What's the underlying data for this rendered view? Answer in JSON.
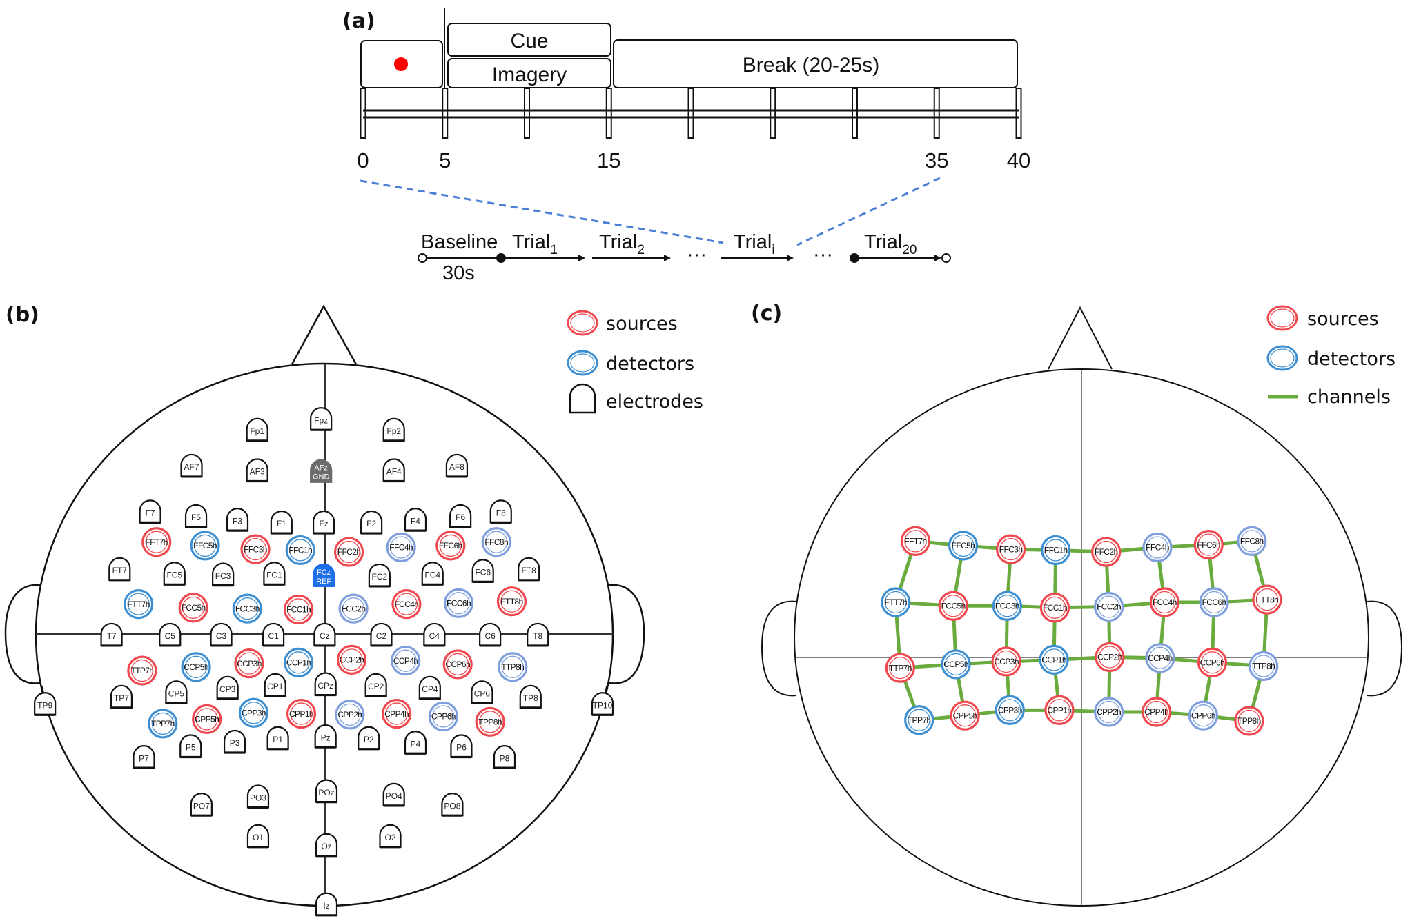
{
  "panels": {
    "a": {
      "label": "(a)",
      "boxes": {
        "fixation_dot_color": "#ff0000",
        "cue": "Cue",
        "imagery": "Imagery",
        "break": "Break (20-25s)"
      },
      "timeline": {
        "ticks_seconds": [
          0,
          5,
          10,
          15,
          20,
          25,
          30,
          35,
          40
        ],
        "tick_labels": [
          "0",
          "5",
          "15",
          "35",
          "40"
        ],
        "tick_label_values": [
          0,
          5,
          15,
          35,
          40
        ]
      },
      "session_flow": {
        "baseline": "Baseline",
        "baseline_duration": "30s",
        "trials": [
          {
            "base": "Trial",
            "sub": "1"
          },
          {
            "base": "Trial",
            "sub": "2"
          },
          {
            "base": "Trial",
            "sub": "i"
          },
          {
            "base": "Trial",
            "sub": "20"
          }
        ],
        "ellipsis": "···"
      }
    },
    "b": {
      "label": "(b)",
      "legend": [
        {
          "key": "sources",
          "label": "sources",
          "color": "#f0484f"
        },
        {
          "key": "detectors",
          "label": "detectors",
          "color": "#3d8fd1"
        },
        {
          "key": "electrodes",
          "label": "electrodes",
          "color": "#111111"
        }
      ],
      "special_electrodes": {
        "AFz": {
          "line1": "AFz",
          "line2": "GND",
          "color": "#6b6b6b"
        },
        "FCz": {
          "line1": "FCz",
          "line2": "REF",
          "color": "#1f6fe8"
        }
      },
      "electrodes": [
        "Fpz",
        "Fp1",
        "Fp2",
        "AF7",
        "AF3",
        "AFz",
        "AF4",
        "AF8",
        "F7",
        "F5",
        "F3",
        "F1",
        "Fz",
        "F2",
        "F4",
        "F6",
        "F8",
        "FT7",
        "FC5",
        "FC3",
        "FC1",
        "FCz",
        "FC2",
        "FC4",
        "FC6",
        "FT8",
        "T7",
        "C5",
        "C3",
        "C1",
        "Cz",
        "C2",
        "C4",
        "C6",
        "T8",
        "TP7",
        "CP5",
        "CP3",
        "CP1",
        "CPz",
        "CP2",
        "CP4",
        "CP6",
        "TP8",
        "TP9",
        "TP10",
        "P7",
        "P5",
        "P3",
        "P1",
        "Pz",
        "P2",
        "P4",
        "P6",
        "P8",
        "PO7",
        "PO3",
        "POz",
        "PO4",
        "PO8",
        "O1",
        "Oz",
        "O2",
        "Iz"
      ]
    },
    "c": {
      "label": "(c)",
      "legend": [
        {
          "key": "sources",
          "label": "sources",
          "color": "#f0484f"
        },
        {
          "key": "detectors",
          "label": "detectors",
          "color": "#3d8fd1"
        },
        {
          "key": "channels",
          "label": "channels",
          "color": "#6aab3e"
        }
      ]
    }
  },
  "optodes": {
    "colors": {
      "source": "#f0484f",
      "detector_left": "#3d8fd1",
      "detector_right": "#7f9fdc",
      "channel": "#6aab3e"
    },
    "rows": [
      [
        {
          "name": "FFT7h",
          "type": "S"
        },
        {
          "name": "FFC5h",
          "type": "D"
        },
        {
          "name": "FFC3h",
          "type": "S"
        },
        {
          "name": "FFC1h",
          "type": "D"
        },
        {
          "name": "FFC2h",
          "type": "S"
        },
        {
          "name": "FFC4h",
          "type": "D"
        },
        {
          "name": "FFC6h",
          "type": "S"
        },
        {
          "name": "FFC8h",
          "type": "D"
        }
      ],
      [
        {
          "name": "FTT7h",
          "type": "D"
        },
        {
          "name": "FCC5h",
          "type": "S"
        },
        {
          "name": "FCC3h",
          "type": "D"
        },
        {
          "name": "FCC1h",
          "type": "S"
        },
        {
          "name": "FCC2h",
          "type": "D"
        },
        {
          "name": "FCC4h",
          "type": "S"
        },
        {
          "name": "FCC6h",
          "type": "D"
        },
        {
          "name": "FTT8h",
          "type": "S"
        }
      ],
      [
        {
          "name": "TTP7h",
          "type": "S"
        },
        {
          "name": "CCP5h",
          "type": "D"
        },
        {
          "name": "CCP3h",
          "type": "S"
        },
        {
          "name": "CCP1h",
          "type": "D"
        },
        {
          "name": "CCP2h",
          "type": "S"
        },
        {
          "name": "CCP4h",
          "type": "D"
        },
        {
          "name": "CCP6h",
          "type": "S"
        },
        {
          "name": "TTP8h",
          "type": "D"
        }
      ],
      [
        {
          "name": "TPP7h",
          "type": "D"
        },
        {
          "name": "CPP5h",
          "type": "S"
        },
        {
          "name": "CPP3h",
          "type": "D"
        },
        {
          "name": "CPP1h",
          "type": "S"
        },
        {
          "name": "CPP2h",
          "type": "D"
        },
        {
          "name": "CPP4h",
          "type": "S"
        },
        {
          "name": "CPP6h",
          "type": "D"
        },
        {
          "name": "TPP8h",
          "type": "S"
        }
      ]
    ]
  }
}
